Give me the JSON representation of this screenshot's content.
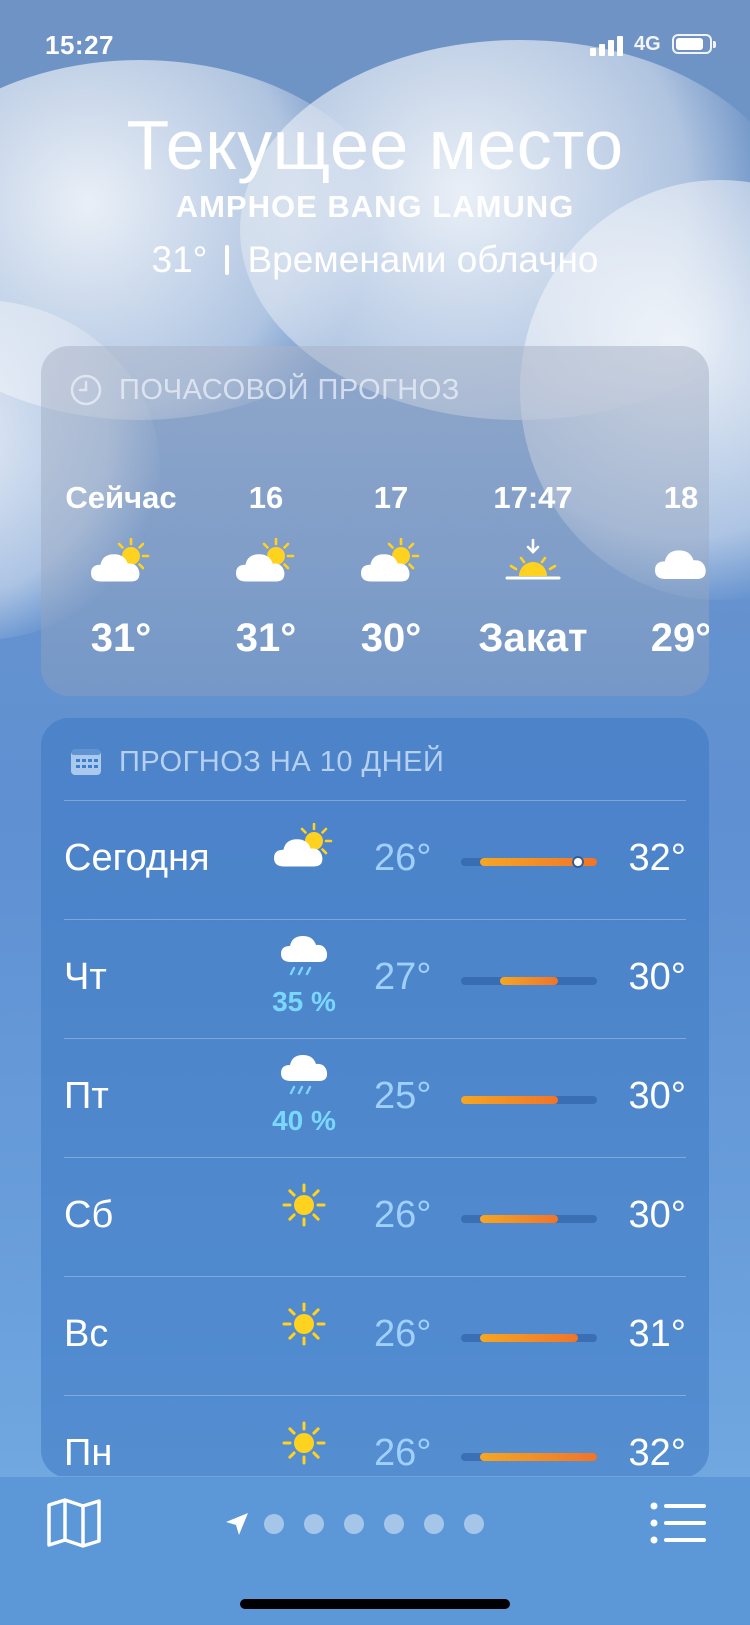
{
  "status_bar": {
    "time": "15:27",
    "network": "4G",
    "battery_percent": 90
  },
  "location": {
    "title": "Текущее место",
    "subtitle": "AMPHOE BANG LAMUNG",
    "temperature": "31°",
    "condition": "Временами облачно"
  },
  "hourly": {
    "header": "ПОЧАСОВОЙ ПРОГНОЗ",
    "items": [
      {
        "label": "Сейчас",
        "icon": "partly-cloudy-icon",
        "value": "31°"
      },
      {
        "label": "16",
        "icon": "partly-cloudy-icon",
        "value": "31°"
      },
      {
        "label": "17",
        "icon": "partly-cloudy-icon",
        "value": "30°"
      },
      {
        "label": "17:47",
        "icon": "sunset-icon",
        "value": "Закат"
      },
      {
        "label": "18",
        "icon": "cloud-icon",
        "value": "29°"
      }
    ]
  },
  "daily": {
    "header": "ПРОГНОЗ НА 10 ДНЕЙ",
    "range_min": 25,
    "range_max": 32,
    "current_temp": 31,
    "rows": [
      {
        "day": "Сегодня",
        "icon": "partly-cloudy-icon",
        "precip": "",
        "low": "26°",
        "high": "32°",
        "low_v": 26,
        "high_v": 32
      },
      {
        "day": "Чт",
        "icon": "rain-cloud-icon",
        "precip": "35 %",
        "low": "27°",
        "high": "30°",
        "low_v": 27,
        "high_v": 30
      },
      {
        "day": "Пт",
        "icon": "rain-cloud-icon",
        "precip": "40 %",
        "low": "25°",
        "high": "30°",
        "low_v": 25,
        "high_v": 30
      },
      {
        "day": "Сб",
        "icon": "sun-icon",
        "precip": "",
        "low": "26°",
        "high": "30°",
        "low_v": 26,
        "high_v": 30
      },
      {
        "day": "Вс",
        "icon": "sun-icon",
        "precip": "",
        "low": "26°",
        "high": "31°",
        "low_v": 26,
        "high_v": 31
      },
      {
        "day": "Пн",
        "icon": "sun-icon",
        "precip": "",
        "low": "26°",
        "high": "32°",
        "low_v": 26,
        "high_v": 32
      }
    ]
  },
  "toolbar": {
    "page_count": 6
  },
  "colors": {
    "bar_start": "#f5a623",
    "bar_end": "#f0742a",
    "low_temp": "#9fd0ff",
    "precip": "#7ad7ff"
  }
}
